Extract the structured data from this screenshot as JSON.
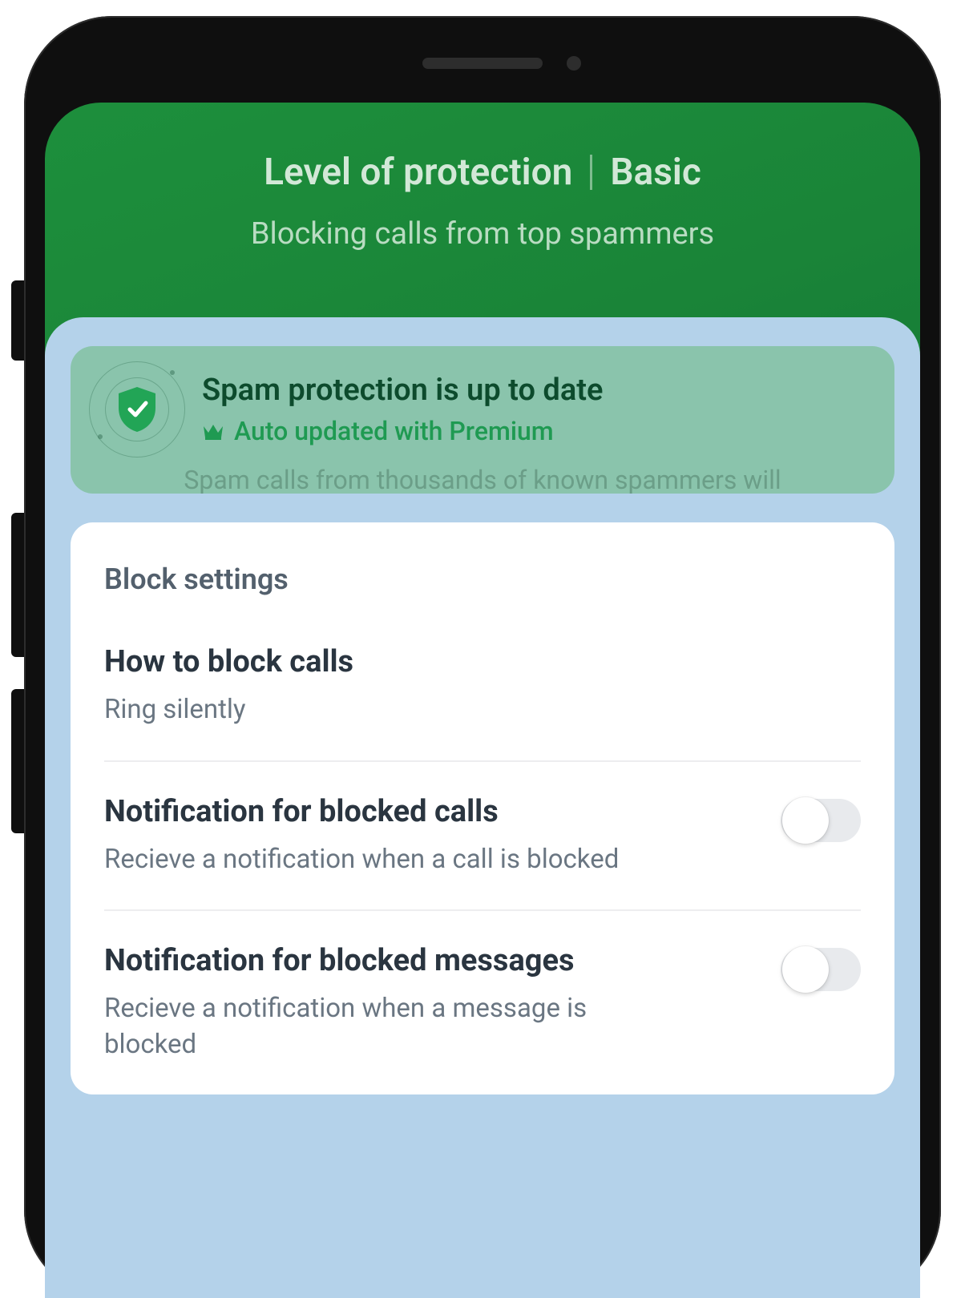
{
  "header": {
    "title_left": "Level of protection",
    "title_right": "Basic",
    "subtitle": "Blocking calls from top spammers"
  },
  "status": {
    "title": "Spam protection is up to date",
    "sub": "Auto updated with Premium",
    "fade_text": "Spam calls from thousands of known spammers will"
  },
  "settings": {
    "heading": "Block settings",
    "rows": [
      {
        "title": "How to block calls",
        "sub": "Ring silently",
        "has_toggle": false,
        "toggle_on": false
      },
      {
        "title": "Notification for blocked calls",
        "sub": "Recieve a notification when a call is blocked",
        "has_toggle": true,
        "toggle_on": false
      },
      {
        "title": "Notification for blocked messages",
        "sub": "Recieve a notification when a message is blocked",
        "has_toggle": true,
        "toggle_on": false
      }
    ]
  },
  "colors": {
    "brand_green": "#1f9a52",
    "dark_green": "#0d4b2d",
    "panel_blue": "#b4d2ea",
    "status_bg": "#8ac4ac"
  }
}
